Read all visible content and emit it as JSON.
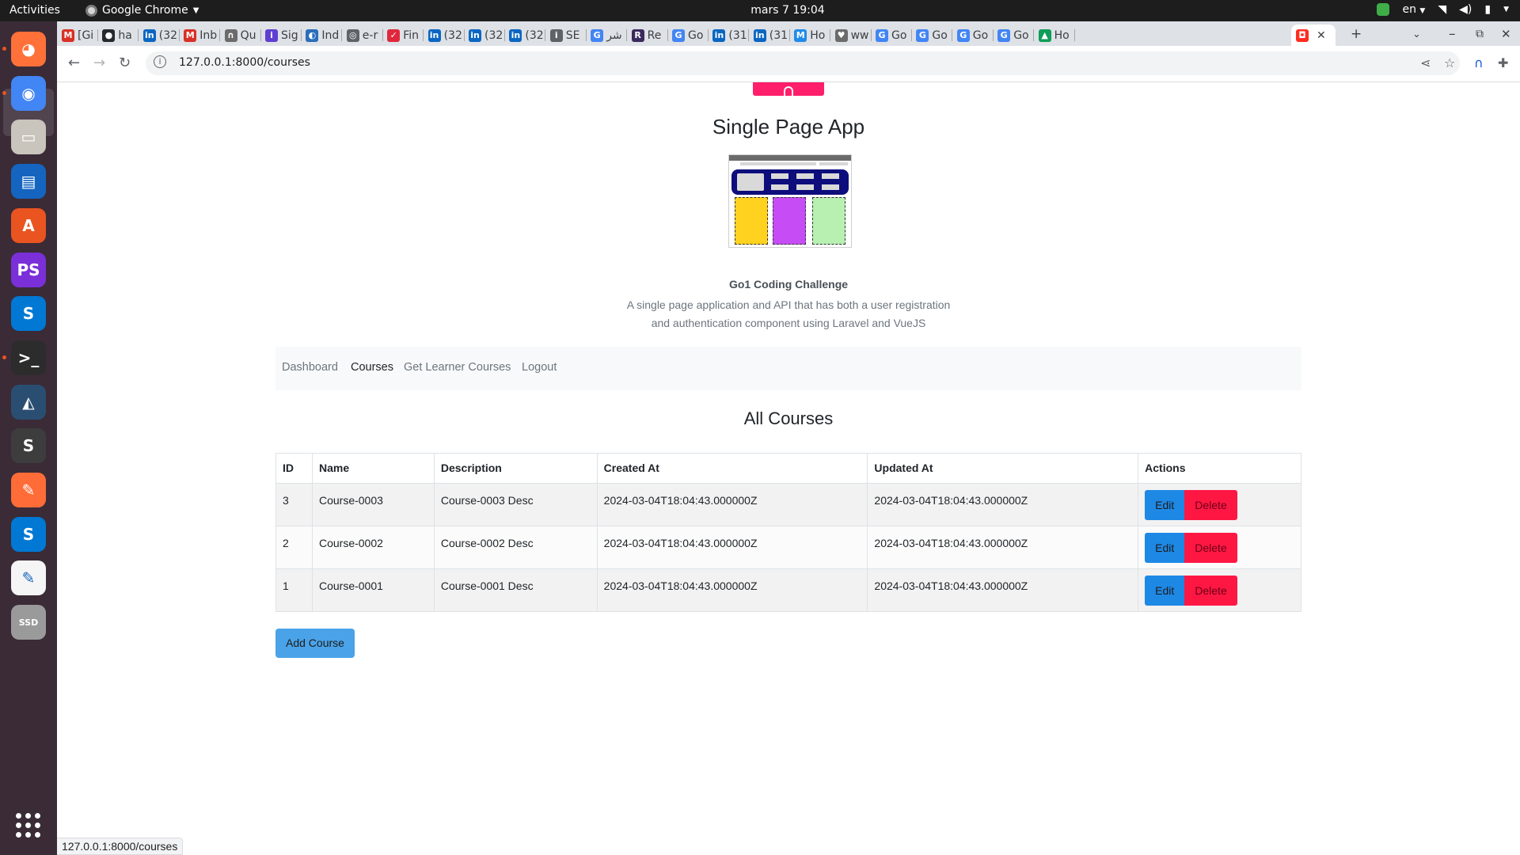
{
  "system": {
    "activities": "Activities",
    "app_name": "Google Chrome",
    "clock": "mars 7  19:04",
    "lang": "en"
  },
  "browser": {
    "tabs": [
      {
        "label": "[Gi",
        "icon": "gmail-icon",
        "color": "#d93025",
        "glyph": "M"
      },
      {
        "label": "ha",
        "icon": "github-icon",
        "color": "#24292e",
        "glyph": "●"
      },
      {
        "label": "(32",
        "icon": "linkedin-icon",
        "color": "#0a66c2",
        "glyph": "in"
      },
      {
        "label": "Inb",
        "icon": "gmail-icon",
        "color": "#d93025",
        "glyph": "M"
      },
      {
        "label": "Qu",
        "icon": "quora-icon",
        "color": "#6b6b6b",
        "glyph": "∩"
      },
      {
        "label": "Sig",
        "icon": "info-icon",
        "color": "#5f3fd1",
        "glyph": "i"
      },
      {
        "label": "Ind",
        "icon": "globe-icon",
        "color": "#2a6ebb",
        "glyph": "◐"
      },
      {
        "label": "e-r",
        "icon": "globe-icon",
        "color": "#5f6368",
        "glyph": "◎"
      },
      {
        "label": "Fin",
        "icon": "finance-icon",
        "color": "#e0283d",
        "glyph": "✓"
      },
      {
        "label": "(32",
        "icon": "linkedin-icon",
        "color": "#0a66c2",
        "glyph": "in"
      },
      {
        "label": "(32",
        "icon": "linkedin-icon",
        "color": "#0a66c2",
        "glyph": "in"
      },
      {
        "label": "(32",
        "icon": "linkedin-icon",
        "color": "#0a66c2",
        "glyph": "in"
      },
      {
        "label": "SE",
        "icon": "info-icon",
        "color": "#5f6368",
        "glyph": "i"
      },
      {
        "label": "شر",
        "icon": "google-icon",
        "color": "#4285f4",
        "glyph": "G"
      },
      {
        "label": "Re",
        "icon": "repl-icon",
        "color": "#3b2a5c",
        "glyph": "R"
      },
      {
        "label": "Go",
        "icon": "translate-icon",
        "color": "#4285f4",
        "glyph": "G"
      },
      {
        "label": "(31",
        "icon": "linkedin-icon",
        "color": "#0a66c2",
        "glyph": "in"
      },
      {
        "label": "(31",
        "icon": "linkedin-icon",
        "color": "#0a66c2",
        "glyph": "in"
      },
      {
        "label": "Ho",
        "icon": "malt-icon",
        "color": "#1f8ceb",
        "glyph": "M"
      },
      {
        "label": "ww",
        "icon": "bird-icon",
        "color": "#6b6b6b",
        "glyph": "♥"
      },
      {
        "label": "Go",
        "icon": "translate-icon",
        "color": "#4285f4",
        "glyph": "G"
      },
      {
        "label": "Go",
        "icon": "translate-icon",
        "color": "#4285f4",
        "glyph": "G"
      },
      {
        "label": "Go",
        "icon": "translate-icon",
        "color": "#4285f4",
        "glyph": "G"
      },
      {
        "label": "Go",
        "icon": "translate-icon",
        "color": "#4285f4",
        "glyph": "G"
      },
      {
        "label": "Ho",
        "icon": "drive-icon",
        "color": "#0f9d58",
        "glyph": "▲"
      }
    ],
    "active_tab": {
      "icon": "laravel-icon",
      "color": "#ff2d20",
      "glyph": "◘"
    },
    "url": "127.0.0.1:8000/courses",
    "status_url": "127.0.0.1:8000/courses"
  },
  "app": {
    "title": "Single Page App",
    "tagline_title": "Go1 Coding Challenge",
    "tagline_line1": "A single page application and API that has both a user registration",
    "tagline_line2": "and authentication component using Laravel and VueJS",
    "nav": {
      "dashboard": "Dashboard",
      "courses": "Courses",
      "learner_courses": "Get Learner Courses",
      "logout": "Logout"
    },
    "section_title": "All Courses",
    "table": {
      "headers": [
        "ID",
        "Name",
        "Description",
        "Created At",
        "Updated At",
        "Actions"
      ],
      "rows": [
        {
          "id": "3",
          "name": "Course-0003",
          "description": "Course-0003 Desc",
          "created_at": "2024-03-04T18:04:43.000000Z",
          "updated_at": "2024-03-04T18:04:43.000000Z"
        },
        {
          "id": "2",
          "name": "Course-0002",
          "description": "Course-0002 Desc",
          "created_at": "2024-03-04T18:04:43.000000Z",
          "updated_at": "2024-03-04T18:04:43.000000Z"
        },
        {
          "id": "1",
          "name": "Course-0001",
          "description": "Course-0001 Desc",
          "created_at": "2024-03-04T18:04:43.000000Z",
          "updated_at": "2024-03-04T18:04:43.000000Z"
        }
      ],
      "edit_label": "Edit",
      "delete_label": "Delete"
    },
    "add_button": "Add Course",
    "colors": {
      "brand_pink": "#ff1f6b",
      "edit_blue": "#1e88e5",
      "delete_red": "#ff1744",
      "add_blue": "#4aa3e8"
    }
  },
  "dock": {
    "apps": [
      {
        "name": "firefox-icon",
        "color": "#ff7139",
        "glyph": "◕"
      },
      {
        "name": "chrome-icon",
        "color": "#4285f4",
        "glyph": "◉"
      },
      {
        "name": "files-icon",
        "color": "#c9c4bc",
        "glyph": "▭"
      },
      {
        "name": "writer-icon",
        "color": "#1565c0",
        "glyph": "▤"
      },
      {
        "name": "app-center-icon",
        "color": "#e95420",
        "glyph": "A"
      },
      {
        "name": "phpstorm-icon",
        "color": "#7b2fd9",
        "glyph": "PS"
      },
      {
        "name": "skype-icon",
        "color": "#0078d4",
        "glyph": "S"
      },
      {
        "name": "terminal-icon",
        "color": "#2c2c2c",
        "glyph": ">_"
      },
      {
        "name": "mysql-workbench-icon",
        "color": "#2a4e72",
        "glyph": "◭"
      },
      {
        "name": "sublime-icon",
        "color": "#3d3d3d",
        "glyph": "S"
      },
      {
        "name": "postman-icon",
        "color": "#ff6c37",
        "glyph": "✎"
      },
      {
        "name": "skype-icon",
        "color": "#0078d4",
        "glyph": "S"
      },
      {
        "name": "text-editor-icon",
        "color": "#f5f5f5",
        "glyph": "✎"
      },
      {
        "name": "ssd-icon",
        "color": "#9a9a9a",
        "glyph": "SSD"
      }
    ]
  }
}
